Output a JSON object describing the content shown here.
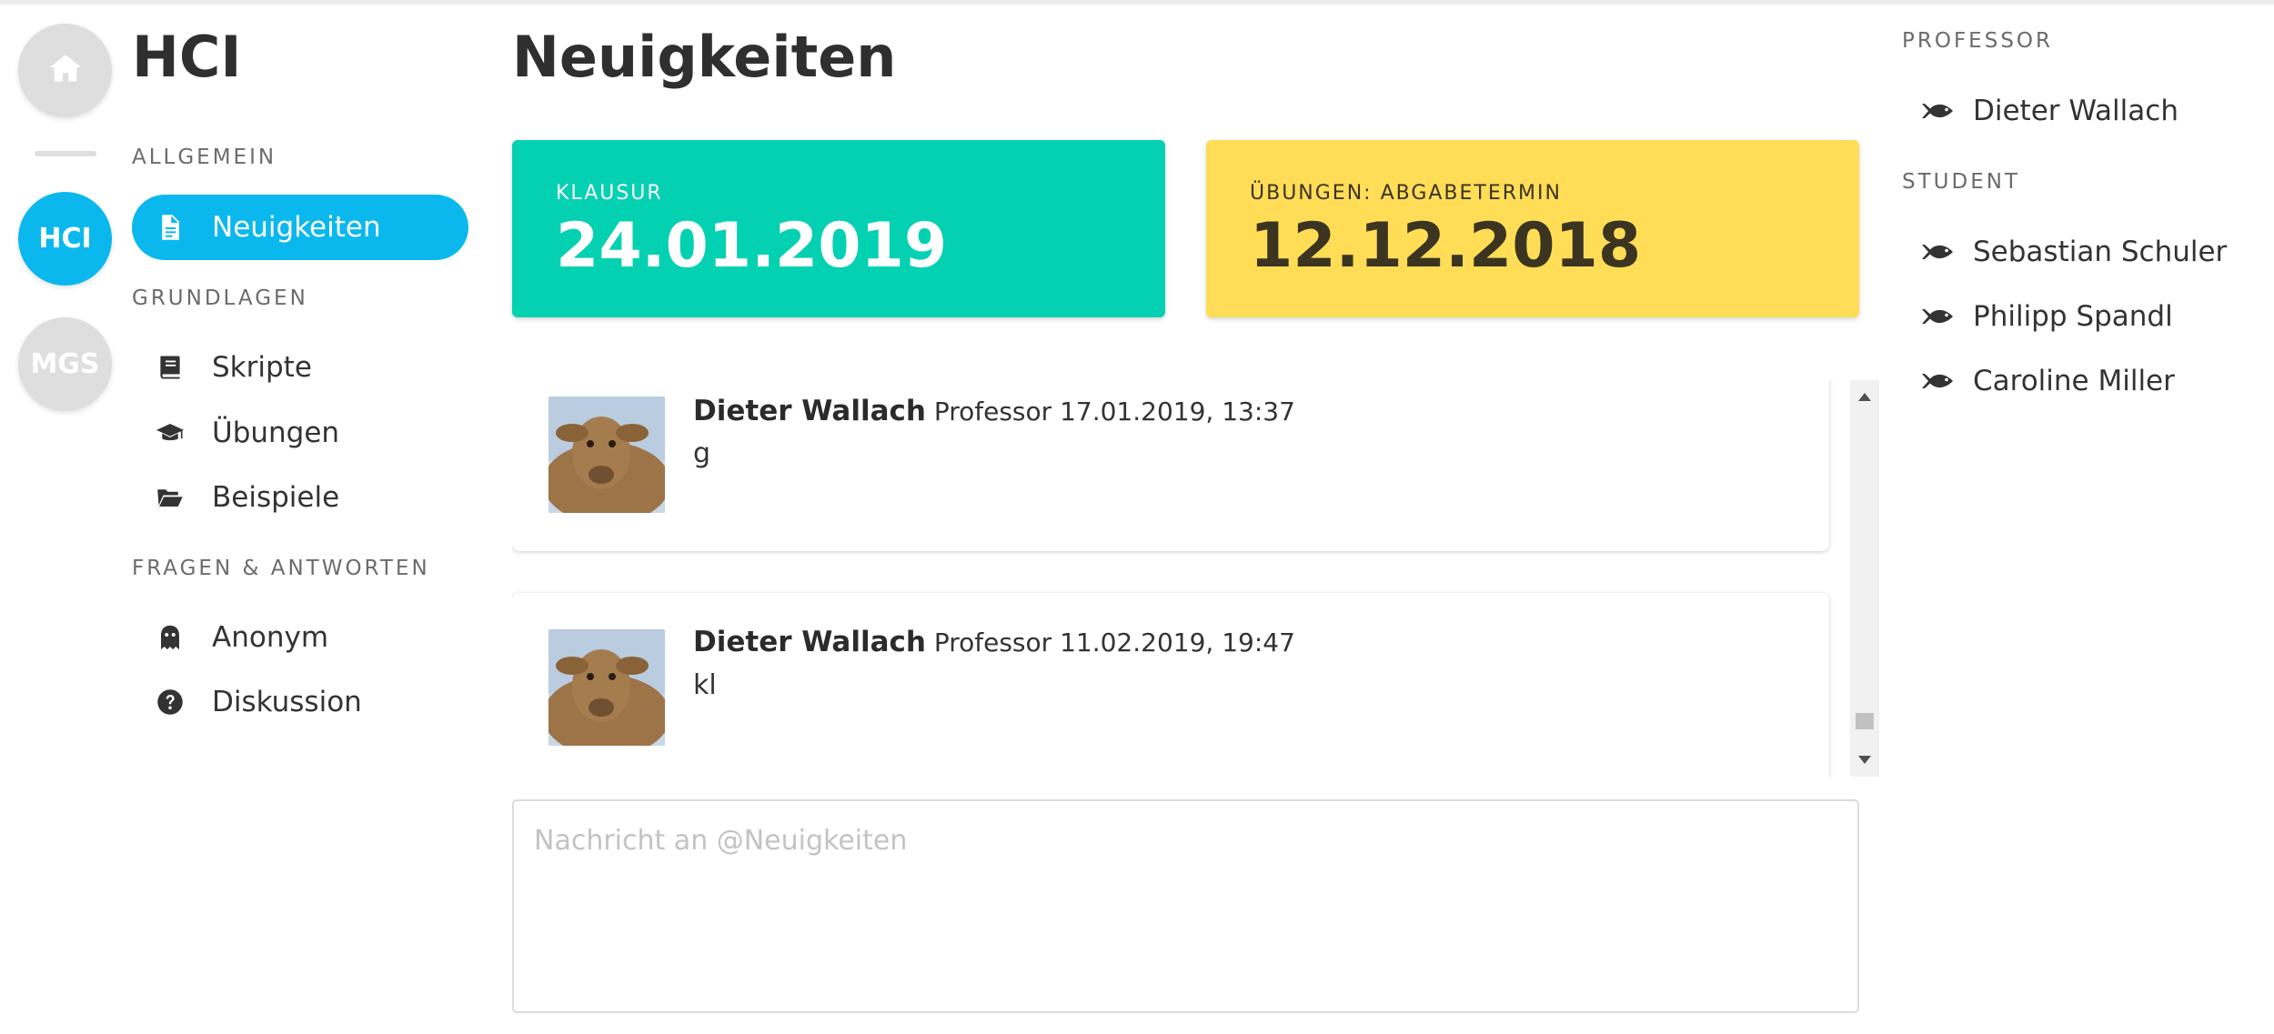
{
  "app": {
    "servers": [
      {
        "label": "",
        "icon": "home-icon"
      },
      {
        "label": "HCI",
        "active": true
      },
      {
        "label": "MGS"
      }
    ]
  },
  "sidebar": {
    "course_title": "HCI",
    "sections": [
      {
        "heading": "ALLGEMEIN",
        "channels": [
          {
            "label": "Neuigkeiten",
            "icon": "document-icon",
            "active": true
          }
        ]
      },
      {
        "heading": "GRUNDLAGEN",
        "channels": [
          {
            "label": "Skripte",
            "icon": "book-icon"
          },
          {
            "label": "Übungen",
            "icon": "graduation-cap-icon"
          },
          {
            "label": "Beispiele",
            "icon": "folder-open-icon"
          }
        ]
      },
      {
        "heading": "FRAGEN & ANTWORTEN",
        "channels": [
          {
            "label": "Anonym",
            "icon": "ghost-icon"
          },
          {
            "label": "Diskussion",
            "icon": "question-circle-icon"
          }
        ]
      }
    ]
  },
  "main": {
    "title": "Neuigkeiten",
    "cards": [
      {
        "label": "KLAUSUR",
        "date": "24.01.2019",
        "color": "#03d1b2"
      },
      {
        "label": "ÜBUNGEN: ABGABETERMIN",
        "date": "12.12.2018",
        "color": "#ffdd57"
      }
    ],
    "messages": [
      {
        "author": "Dieter Wallach",
        "role": "Professor",
        "timestamp": "17.01.2019, 13:37",
        "text": "g"
      },
      {
        "author": "Dieter Wallach",
        "role": "Professor",
        "timestamp": "11.02.2019, 19:47",
        "text": "kl"
      }
    ],
    "composer": {
      "placeholder": "Nachricht an @Neuigkeiten",
      "value": ""
    }
  },
  "members": {
    "groups": [
      {
        "heading": "PROFESSOR",
        "names": [
          "Dieter Wallach"
        ]
      },
      {
        "heading": "STUDENT",
        "names": [
          "Sebastian Schuler",
          "Philipp Spandl",
          "Caroline Miller"
        ]
      }
    ],
    "icon": "fish-icon"
  },
  "colors": {
    "accent": "#0ab8ee",
    "teal": "#03d1b2",
    "yellow": "#ffdd57"
  }
}
